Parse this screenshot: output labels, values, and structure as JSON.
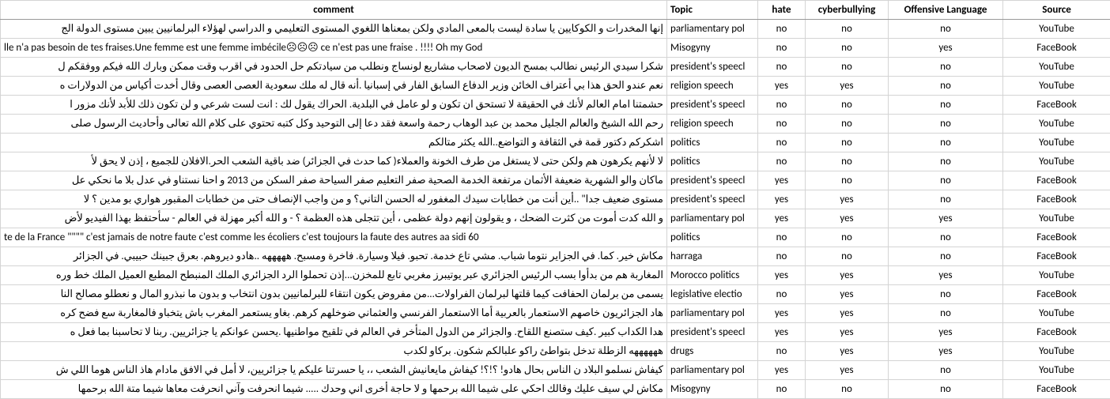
{
  "headers": {
    "comment": "comment",
    "topic": "Topic",
    "hate": "hate",
    "cyberbullying": "cyberbullying",
    "offensive": "Offensive Language",
    "source": "Source"
  },
  "rows": [
    {
      "comment": "إنها المخدرات و الكوكايين يا سادة ليست بالمعى المادي ولكن بمعناها اللغوي المستوى التعليمي و الدراسي لهؤلاء البرلمانيين يبين مستوى الدولة الج",
      "topic": "parliamentary pol",
      "hate": "no",
      "cyber": "no",
      "offensive": "no",
      "source": "YouTube",
      "dir": "rtl"
    },
    {
      "comment": "lle n'a pas besoin de tes fraises.Une femme est une femme imbécile☹☹☹ ce n'est pas une fraise . !!!! Oh my God",
      "topic": "Misogyny",
      "hate": "no",
      "cyber": "no",
      "offensive": "yes",
      "source": "FaceBook",
      "dir": "ltr"
    },
    {
      "comment": "شكرا سيدي الرئيس نطالب بمسح الديون لاصحاب مشاريع لونساج ونطلب من سيادتكم حل الحدود في اقرب وقت ممكن وبارك الله فيكم ووفقكم ل",
      "topic": "president's speecl",
      "hate": "no",
      "cyber": "no",
      "offensive": "no",
      "source": "YouTube",
      "dir": "rtl"
    },
    {
      "comment": "نعم عندو الحق هذا بي أعتراف الخائن وزير الدفاع السابق الفار في إسبانيا .أنه قال له ملك سعودية العصى العصى وقال أخدت أكياس من الدولارات ه",
      "topic": "religion speech",
      "hate": "yes",
      "cyber": "yes",
      "offensive": "no",
      "source": "YouTube",
      "dir": "rtl"
    },
    {
      "comment": "حشمتنا امام العالم لأنك في الحقيقة لا تستحق ان تكون و لو عامل في البلدية. الحراك يقول لك : انت لست شرعي و لن تكون ذلك للأبد لأنك مزور ا",
      "topic": "president's speecl",
      "hate": "no",
      "cyber": "no",
      "offensive": "no",
      "source": "FaceBook",
      "dir": "rtl"
    },
    {
      "comment": "رحم الله الشيخ والعالم الجليل محمد بن عبد الوهاب رحمة واسعة فقد دعا إلى التوحيد وكل كتبه تحتوي على كلام الله تعالى وأحاديث الرسول صلى",
      "topic": "religion speech",
      "hate": "no",
      "cyber": "no",
      "offensive": "no",
      "source": "YouTube",
      "dir": "rtl"
    },
    {
      "comment": "اشكركم دكتور قمة في الثقافة و التواضع..الله يكثر متالكم",
      "topic": "politics",
      "hate": "no",
      "cyber": "no",
      "offensive": "no",
      "source": "YouTube",
      "dir": "rtl"
    },
    {
      "comment": "لا لأنهم يكرهون هم ولكن حتى لا يستغل من طرف الخونة والعملاء( كما حدث في الجزائر) ضد باقية الشعب الحر.الافلان للجميع ، إذن لا يحق لأ",
      "topic": "politics",
      "hate": "no",
      "cyber": "no",
      "offensive": "no",
      "source": "YouTube",
      "dir": "rtl"
    },
    {
      "comment": "ماكان والو الشهرية ضعيفة الأثمان مرتفعة الخدمة الصحية صفر التعليم صفر السياحة صفر السكن من 2013 و احنا نستناو في عدل بلا ما نحكي عل",
      "topic": "president's speecl",
      "hate": "yes",
      "cyber": "no",
      "offensive": "no",
      "source": "FaceBook",
      "dir": "rtl"
    },
    {
      "comment": "مستوى ضعيف جدا\" ..أين أنت من خطابات سيدك المغفور له الحسن التاني؟ و من واجب الإنصاف حتى من خطابات المقبور هواري بو مدين ؟ لا",
      "topic": "president's speecl",
      "hate": "yes",
      "cyber": "yes",
      "offensive": "no",
      "source": "FaceBook",
      "dir": "rtl"
    },
    {
      "comment": "و الله كدت أموت من كثرت الضحك ، و يقولون إنهم دولة عظمى ، أين تتجلى هذه العظمة ؟ - و الله أكبر مهزلة في العالم - سأحتفظ بهذا الفيديو لأض",
      "topic": "parliamentary pol",
      "hate": "yes",
      "cyber": "yes",
      "offensive": "yes",
      "source": "YouTube",
      "dir": "rtl"
    },
    {
      "comment": "te de la France \"\"\"\" c'est jamais de notre faute c'est comme les écoliers c'est toujours la faute des autres aa sidi 60",
      "topic": "politics",
      "hate": "no",
      "cyber": "no",
      "offensive": "no",
      "source": "FaceBook",
      "dir": "ltr"
    },
    {
      "comment": "مكاش خير. كما. في الجزاير نتوما شباب. مشي تاع خدمة. تحبو. فيلا وسيارة. فاخرة ومسبح. هههههه ..هادو ديروهم. بعرق جبينك حبيبي. في الجزائر",
      "topic": "harraga",
      "hate": "no",
      "cyber": "no",
      "offensive": "no",
      "source": "FaceBook",
      "dir": "rtl"
    },
    {
      "comment": "المغاربة هم من بدأوا بسب الرئيس الجزائري عبر يوتيبرز مغربي تابع للمخزن...إذن تحملوا الرد الجزائري الملك المنبطح المطبع العميل الملك خط وره",
      "topic": "Morocco politics",
      "hate": "yes",
      "cyber": "yes",
      "offensive": "yes",
      "source": "YouTube",
      "dir": "rtl"
    },
    {
      "comment": "يسمى من برلمان الحفافت كيما قلتها لبرلمان الفراولات...من مفروض يكون انتقاء للبرلمانيين بدون انتخاب و بدون ما نبذرو المال و نعطلو مصالح النا",
      "topic": "legislative electio",
      "hate": "no",
      "cyber": "yes",
      "offensive": "no",
      "source": "FaceBook",
      "dir": "rtl"
    },
    {
      "comment": "هاد الجزائريون خاصهم الاستعمار بالعربية أما الاستعمار الفرنسي والعثماني ضوخلهم كرهم. بغاو يستعمر المغرب باش يتخباو فالمغاربة سع فضح كره",
      "topic": "parliamentary pol",
      "hate": "yes",
      "cyber": "yes",
      "offensive": "no",
      "source": "YouTube",
      "dir": "rtl"
    },
    {
      "comment": "هدا الكداب كبير .كيف ستصنع اللقاح. والجزائر من الدول المتأخر في العالم في تلقيح مواطنيها .يحسن عوانكم يا جزائريين. ربنا لا تحاسبنا بما فعل ه",
      "topic": "president's speecl",
      "hate": "yes",
      "cyber": "yes",
      "offensive": "yes",
      "source": "FaceBook",
      "dir": "rtl"
    },
    {
      "comment": "ههههههه الزطلة تدخل بتواطئ راكو علبالكم شكون. بركاو لكدب",
      "topic": "drugs",
      "hate": "no",
      "cyber": "yes",
      "offensive": "yes",
      "source": "YouTube",
      "dir": "rtl"
    },
    {
      "comment": "كيفاش نسلمو البلاد ن الناس بحال هادو! ؟!؟! كيفاش مايعانيش الشعب ،، يا حسرتنا عليكم يا جزائريين، لا أمل في الافق مادام هاذ الناس هوما اللي ش",
      "topic": "parliamentary pol",
      "hate": "yes",
      "cyber": "yes",
      "offensive": "no",
      "source": "YouTube",
      "dir": "rtl"
    },
    {
      "comment": "مكاش لي سيف عليك وقالك احكي على شيما الله برحمها و لا حاجة أخرى اني وحدك ..... شيما انحرفت وآني انحرفت معاها شيما متة الله برحمها",
      "topic": "Misogyny",
      "hate": "no",
      "cyber": "no",
      "offensive": "no",
      "source": "FaceBook",
      "dir": "rtl"
    }
  ]
}
